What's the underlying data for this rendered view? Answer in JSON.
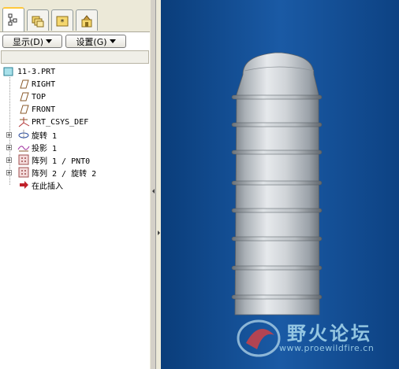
{
  "navigator": {
    "tabs": [
      {
        "icon": "model-tree-icon",
        "active": true
      },
      {
        "icon": "folder-browser-icon",
        "active": false
      },
      {
        "icon": "favorites-icon",
        "active": false
      },
      {
        "icon": "connections-icon",
        "active": false
      }
    ],
    "show_button": "显示(D)",
    "settings_button": "设置(G)",
    "tree": [
      {
        "label": "11-3.PRT",
        "icon": "part-icon",
        "expandable": false
      },
      {
        "label": "RIGHT",
        "icon": "datum-plane-icon",
        "expandable": false
      },
      {
        "label": "TOP",
        "icon": "datum-plane-icon",
        "expandable": false
      },
      {
        "label": "FRONT",
        "icon": "datum-plane-icon",
        "expandable": false
      },
      {
        "label": "PRT_CSYS_DEF",
        "icon": "coordinate-system-icon",
        "expandable": false
      },
      {
        "label": "旋转 1",
        "icon": "revolve-icon",
        "expandable": true
      },
      {
        "label": "投影 1",
        "icon": "projection-icon",
        "expandable": true
      },
      {
        "label": "阵列 1 / PNT0",
        "icon": "pattern-icon",
        "expandable": true
      },
      {
        "label": "阵列 2 / 旋转 2",
        "icon": "pattern-icon",
        "expandable": true
      },
      {
        "label": "在此插入",
        "icon": "insert-here-arrow-icon",
        "expandable": false
      }
    ]
  },
  "graphics": {
    "background_color": "#1a5aa5",
    "model_color": "#c8cdd2",
    "watermark": {
      "title": "野火论坛",
      "url": "www.proewildfire.cn"
    }
  }
}
